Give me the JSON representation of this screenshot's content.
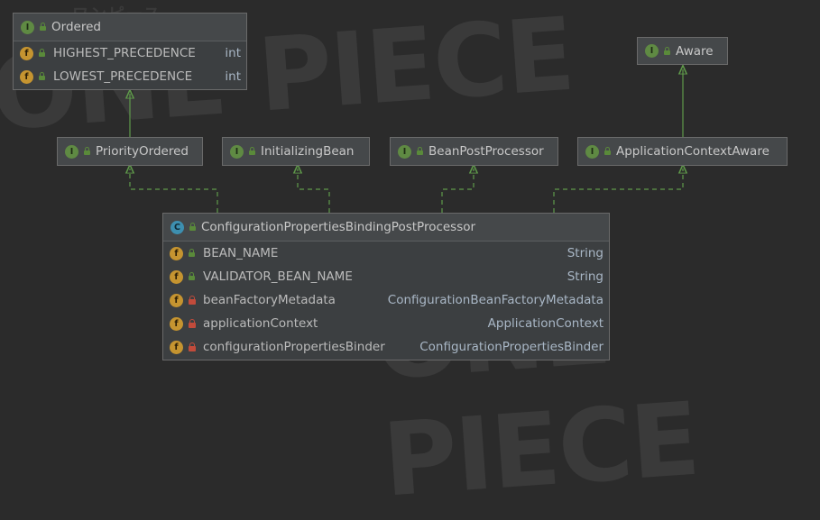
{
  "watermark": {
    "brand_text": "ONE PIECE",
    "kana_text": "ワンピース"
  },
  "colors": {
    "background": "#2b2b2b",
    "node_fill": "#3c3f41",
    "node_header": "#45484a",
    "interface_badge": "#5f8a43",
    "class_badge": "#3d8fb0",
    "field_badge": "#c59430",
    "public_lock": "#5a8a3a",
    "private_lock": "#c24b3b",
    "inheritance_arrow": "#5f9a4a"
  },
  "nodes": {
    "ordered": {
      "kind": "interface",
      "badge": "I",
      "name": "Ordered",
      "fields": [
        {
          "badge": "f",
          "static": true,
          "visibility": "public",
          "name": "HIGHEST_PRECEDENCE",
          "type": "int"
        },
        {
          "badge": "f",
          "static": true,
          "visibility": "public",
          "name": "LOWEST_PRECEDENCE",
          "type": "int"
        }
      ]
    },
    "aware": {
      "kind": "interface",
      "badge": "I",
      "name": "Aware"
    },
    "priority_ordered": {
      "kind": "interface",
      "badge": "I",
      "name": "PriorityOrdered"
    },
    "initializing_bean": {
      "kind": "interface",
      "badge": "I",
      "name": "InitializingBean"
    },
    "bean_post_processor": {
      "kind": "interface",
      "badge": "I",
      "name": "BeanPostProcessor"
    },
    "application_context_aware": {
      "kind": "interface",
      "badge": "I",
      "name": "ApplicationContextAware"
    },
    "cpbpp": {
      "kind": "class",
      "badge": "C",
      "name": "ConfigurationPropertiesBindingPostProcessor",
      "fields": [
        {
          "badge": "f",
          "static": true,
          "visibility": "public",
          "name": "BEAN_NAME",
          "type": "String"
        },
        {
          "badge": "f",
          "static": true,
          "visibility": "public",
          "name": "VALIDATOR_BEAN_NAME",
          "type": "String"
        },
        {
          "badge": "f",
          "static": false,
          "visibility": "private",
          "name": "beanFactoryMetadata",
          "type": "ConfigurationBeanFactoryMetadata"
        },
        {
          "badge": "f",
          "static": false,
          "visibility": "private",
          "name": "applicationContext",
          "type": "ApplicationContext"
        },
        {
          "badge": "f",
          "static": false,
          "visibility": "private",
          "name": "configurationPropertiesBinder",
          "type": "ConfigurationPropertiesBinder"
        }
      ]
    }
  },
  "edges": [
    {
      "from": "priority_ordered",
      "to": "ordered",
      "style": "solid"
    },
    {
      "from": "application_context_aware",
      "to": "aware",
      "style": "solid"
    },
    {
      "from": "cpbpp",
      "to": "priority_ordered",
      "style": "dashed"
    },
    {
      "from": "cpbpp",
      "to": "initializing_bean",
      "style": "dashed"
    },
    {
      "from": "cpbpp",
      "to": "bean_post_processor",
      "style": "dashed"
    },
    {
      "from": "cpbpp",
      "to": "application_context_aware",
      "style": "dashed"
    }
  ]
}
